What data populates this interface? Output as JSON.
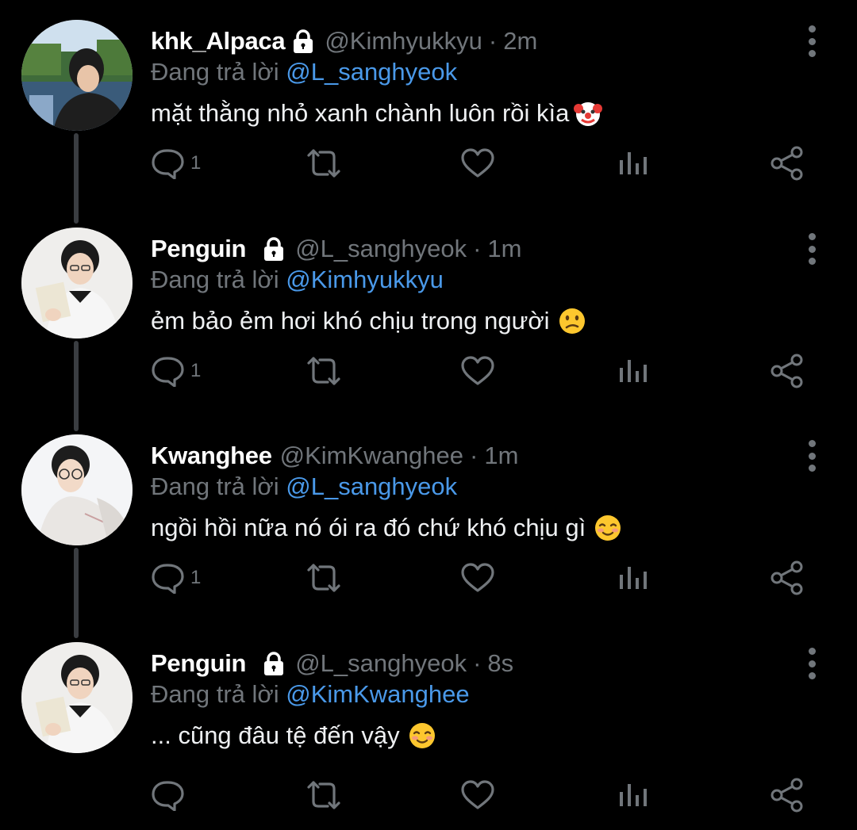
{
  "tweets": [
    {
      "name": "khk_Alpaca",
      "locked": true,
      "handle": "@Kimhyukkyu",
      "separator": "·",
      "time": "2m",
      "reply_prefix": "Đang trả lời",
      "reply_to": "@L_sanghyeok",
      "text": "mặt thằng nhỏ xanh chành luôn rồi kìa",
      "emoji": "clown-face-emoji",
      "reply_count": "1"
    },
    {
      "name": "Penguin",
      "locked": true,
      "handle": "@L_sanghyeok",
      "separator": "·",
      "time": "1m",
      "reply_prefix": "Đang trả lời",
      "reply_to": "@Kimhyukkyu",
      "text": "ẻm bảo ẻm hơi khó chịu trong người",
      "emoji": "confused-face-emoji",
      "reply_count": "1"
    },
    {
      "name": "Kwanghee",
      "locked": false,
      "handle": "@KimKwanghee",
      "separator": "·",
      "time": "1m",
      "reply_prefix": "Đang trả lời",
      "reply_to": "@L_sanghyeok",
      "text": "ngồi hồi nữa nó ói ra đó chứ khó chịu gì",
      "emoji": "smiling-face-emoji",
      "reply_count": "1"
    },
    {
      "name": "Penguin",
      "locked": true,
      "handle": "@L_sanghyeok",
      "separator": "·",
      "time": "8s",
      "reply_prefix": "Đang trả lời",
      "reply_to": "@KimKwanghee",
      "text": "... cũng đâu tệ đến vậy",
      "emoji": "smiling-face-emoji",
      "reply_count": ""
    }
  ],
  "colors": {
    "background": "#000000",
    "text": "#e7e9ea",
    "muted": "#71767b",
    "mention": "#4a99e9",
    "thread_line": "#3a3d41"
  },
  "icons": [
    "reply-icon",
    "retweet-icon",
    "like-icon",
    "analytics-icon",
    "share-icon",
    "more-icon",
    "lock-icon"
  ]
}
